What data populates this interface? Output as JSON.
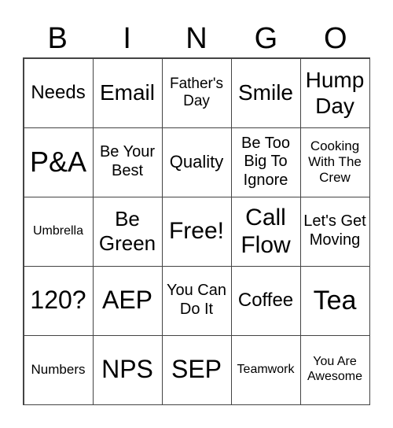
{
  "header": [
    "B",
    "I",
    "N",
    "G",
    "O"
  ],
  "cells": [
    "Needs",
    "Email",
    "Father's Day",
    "Smile",
    "Hump Day",
    "P&A",
    "Be Your Best",
    "Quality",
    "Be Too Big To Ignore",
    "Cooking With The Crew",
    "Umbrella",
    "Be Green",
    "Free!",
    "Call Flow",
    "Let's Get Moving",
    "120?",
    "AEP",
    "You Can Do It",
    "Coffee",
    "Tea",
    "Numbers",
    "NPS",
    "SEP",
    "Teamwork",
    "You Are Awesome"
  ]
}
